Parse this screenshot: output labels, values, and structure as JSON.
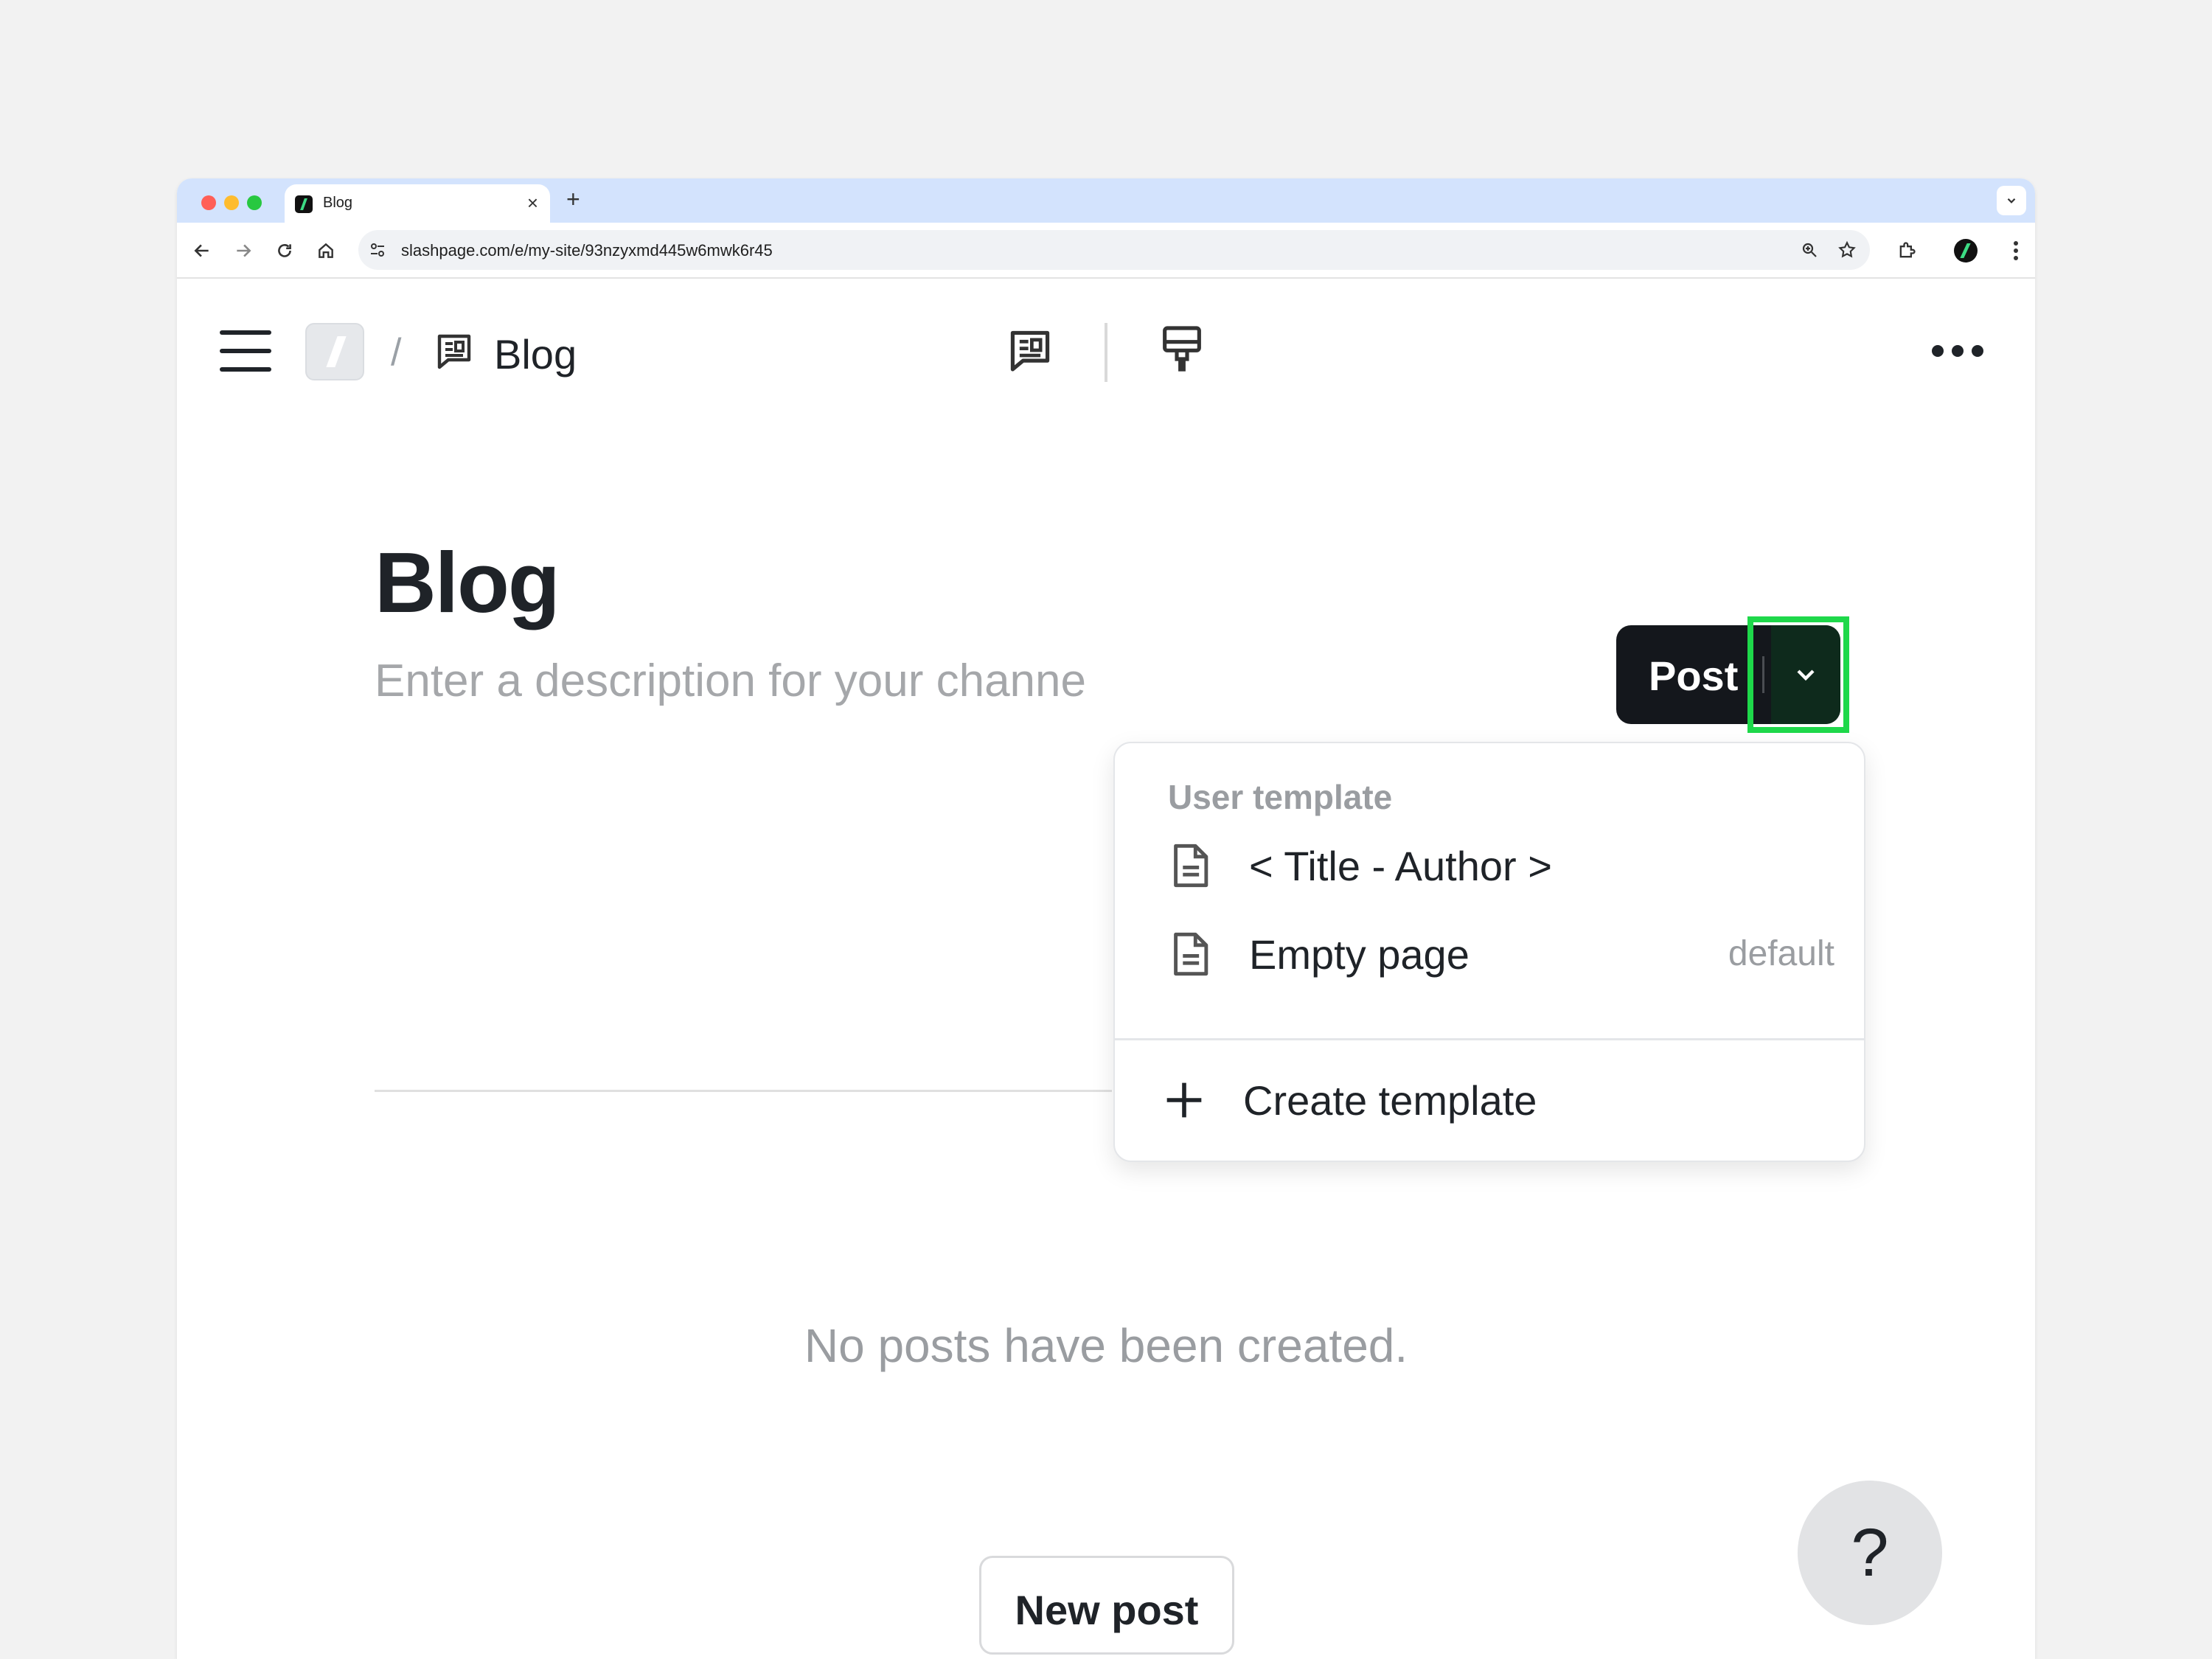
{
  "browser": {
    "tab_title": "Blog",
    "tab_close": "×",
    "new_tab": "+",
    "url": "slashpage.com/e/my-site/93nzyxmd445w6mwk6r45"
  },
  "header": {
    "breadcrumb_separator": "/",
    "channel_title": "Blog"
  },
  "page": {
    "title": "Blog",
    "description_placeholder": "Enter a description for your channe",
    "post_button_label": "Post",
    "empty_message": "No posts have been created.",
    "new_post_label": "New post",
    "help_label": "?"
  },
  "dropdown": {
    "heading": "User template",
    "items": [
      {
        "label": "< Title - Author >",
        "meta": ""
      },
      {
        "label": "Empty page",
        "meta": "default"
      }
    ],
    "create_label": "Create template"
  },
  "colors": {
    "focus_ring": "#1ed84a",
    "post_button": "#14171c",
    "brand_accent": "#3ddc84"
  },
  "icons": {
    "back": "arrow-left-icon",
    "forward": "arrow-right-icon",
    "reload": "reload-icon",
    "home": "home-icon",
    "site_settings": "tune-icon",
    "zoom": "zoom-icon",
    "bookmark": "star-icon",
    "extensions": "puzzle-icon",
    "menu": "kebab-icon"
  }
}
